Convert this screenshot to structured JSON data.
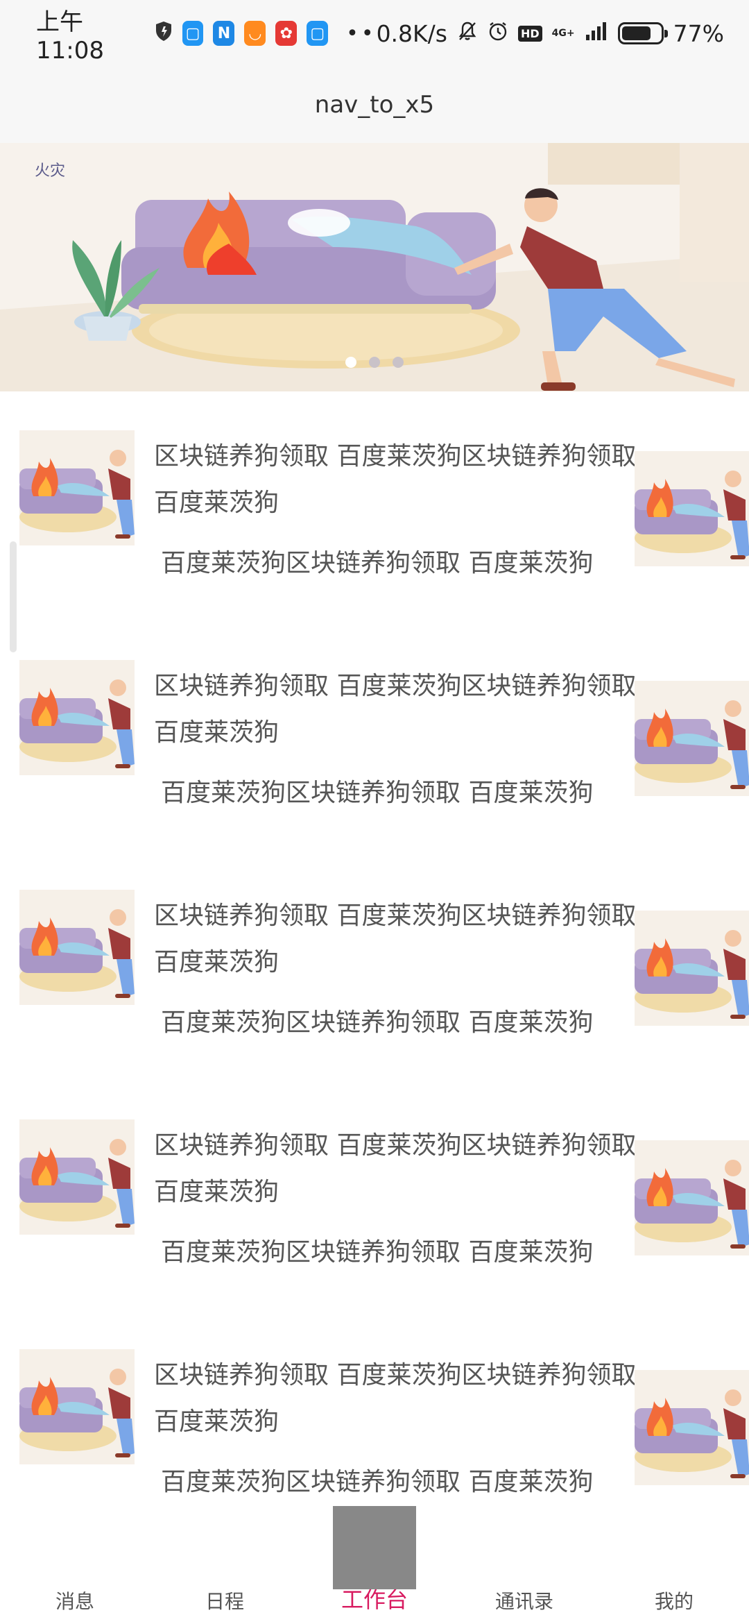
{
  "status_bar": {
    "time": "上午11:08",
    "network_speed": "0.8K/s",
    "battery": "77%",
    "battery_level": 0.77,
    "hd": "HD",
    "net_type": "4G+",
    "icons": [
      "shield-icon",
      "app-icon-blue",
      "n-app-icon",
      "uc-browser-icon",
      "red-app-icon",
      "app-icon-blue-2",
      "more-dots",
      "mute-bell-icon",
      "alarm-icon",
      "hd-icon",
      "signal-icon",
      "battery-icon"
    ]
  },
  "title_bar": {
    "title": "nav_to_x5"
  },
  "banner": {
    "label": "火灾",
    "page_count": 3,
    "active_index": 0
  },
  "list": {
    "items": [
      {
        "title": "区块链养狗领取 百度莱茨狗区块链养狗领取 百度莱茨狗",
        "subtitle": "百度莱茨狗区块链养狗领取 百度莱茨狗"
      },
      {
        "title": "区块链养狗领取 百度莱茨狗区块链养狗领取 百度莱茨狗",
        "subtitle": "百度莱茨狗区块链养狗领取 百度莱茨狗"
      },
      {
        "title": "区块链养狗领取 百度莱茨狗区块链养狗领取 百度莱茨狗",
        "subtitle": "百度莱茨狗区块链养狗领取 百度莱茨狗"
      },
      {
        "title": "区块链养狗领取 百度莱茨狗区块链养狗领取 百度莱茨狗",
        "subtitle": "百度莱茨狗区块链养狗领取 百度莱茨狗"
      },
      {
        "title": "区块链养狗领取 百度莱茨狗区块链养狗领取 百度莱茨狗",
        "subtitle": "百度莱茨狗区块链养狗领取 百度莱茨狗"
      }
    ]
  },
  "bottom_nav": {
    "items": [
      {
        "label": "消息"
      },
      {
        "label": "日程"
      },
      {
        "label": "工作台"
      },
      {
        "label": "通讯录"
      },
      {
        "label": "我的"
      }
    ],
    "active_index": 2
  },
  "colors": {
    "accent": "#d81b60",
    "bar_bg": "#f7f7f7",
    "text": "#555555",
    "center_block": "#888888"
  }
}
